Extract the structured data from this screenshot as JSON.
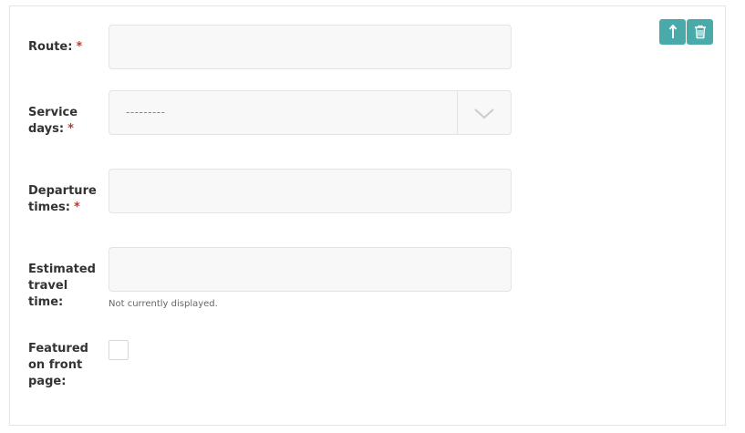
{
  "form": {
    "route": {
      "label": "Route:",
      "required_mark": "*",
      "value": ""
    },
    "service_days": {
      "label_line1": "Service",
      "label_line2": "days:",
      "required_mark": "*",
      "placeholder": "---------"
    },
    "departure_times": {
      "label_line1": "Departure",
      "label_line2": "times:",
      "required_mark": "*",
      "value": ""
    },
    "estimated_travel_time": {
      "label_line1": "Estimated",
      "label_line2": "travel",
      "label_line3": "time:",
      "value": "",
      "help_text": "Not currently displayed."
    },
    "featured": {
      "label_line1": "Featured",
      "label_line2": "on front",
      "label_line3": "page:",
      "checked": false
    }
  },
  "actions": {
    "move_up_icon": "arrow-up-icon",
    "delete_icon": "trash-icon",
    "accent_color": "#4aa9a9"
  }
}
